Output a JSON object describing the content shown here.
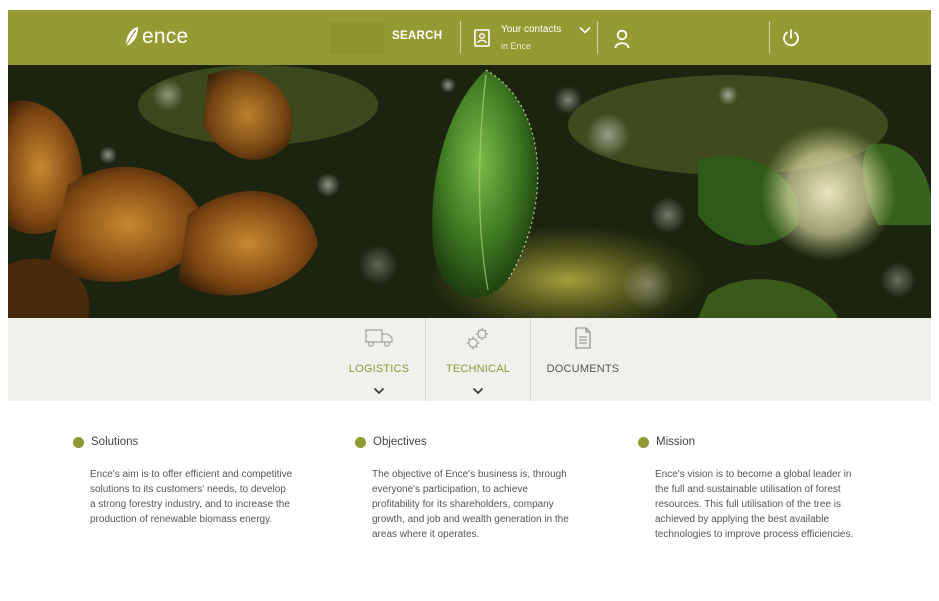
{
  "header": {
    "logo_text": "ence",
    "search_label": "SEARCH",
    "contacts_line1": "Your contacts",
    "contacts_line2": "in Ence"
  },
  "nav": {
    "items": [
      {
        "label": "LOGISTICS",
        "icon": "truck-icon",
        "has_dropdown": true
      },
      {
        "label": "TECHNICAL",
        "icon": "gears-icon",
        "has_dropdown": true
      },
      {
        "label": "DOCUMENTS",
        "icon": "document-icon",
        "has_dropdown": false
      }
    ]
  },
  "columns": [
    {
      "title": "Solutions",
      "body": "Ence's aim is to offer efficient and competitive solutions to its customers' needs, to develop a strong forestry industry, and to increase the production of renewable biomass energy."
    },
    {
      "title": "Objectives",
      "body": "The objective of Ence's business is, through everyone's participation, to achieve profitability for its shareholders, company growth, and job and wealth generation in the areas where it operates."
    },
    {
      "title": "Mission",
      "body": "Ence's vision is to become a global leader in the full and sustainable utilisation of forest resources. This full utilisation of the tree is achieved by applying the best available technologies to improve process efficiencies."
    }
  ],
  "colors": {
    "brand": "#969a32",
    "accent_green": "#8f9a35",
    "nav_bg": "#f0f0ec",
    "text": "#555555"
  }
}
